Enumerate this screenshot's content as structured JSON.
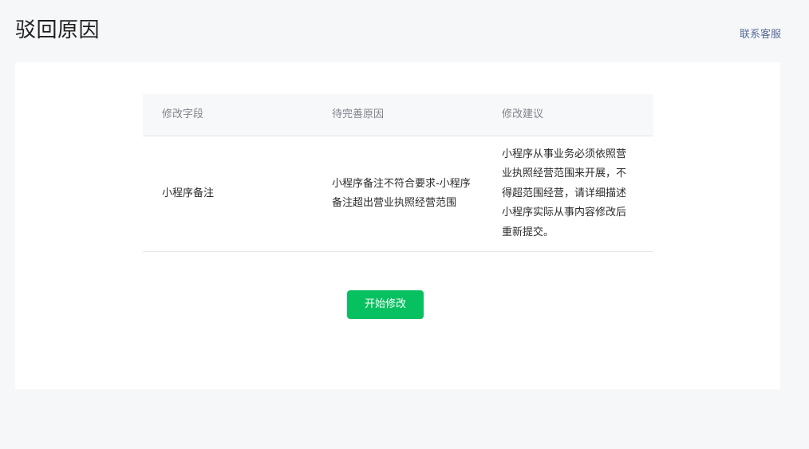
{
  "header": {
    "title": "驳回原因",
    "support_link": "联系客服"
  },
  "table": {
    "columns": [
      "修改字段",
      "待完善原因",
      "修改建议"
    ],
    "rows": [
      {
        "field": "小程序备注",
        "reason": "小程序备注不符合要求-小程序备注超出营业执照经营范围",
        "suggestion": "小程序从事业务必须依照营业执照经营范围来开展，不得超范围经营，请详细描述小程序实际从事内容修改后重新提交。"
      }
    ]
  },
  "actions": {
    "start_edit_label": "开始修改"
  },
  "colors": {
    "primary": "#07c160",
    "link": "#576b95",
    "background": "#f6f7f9",
    "table_header_bg": "#f6f8fa"
  }
}
